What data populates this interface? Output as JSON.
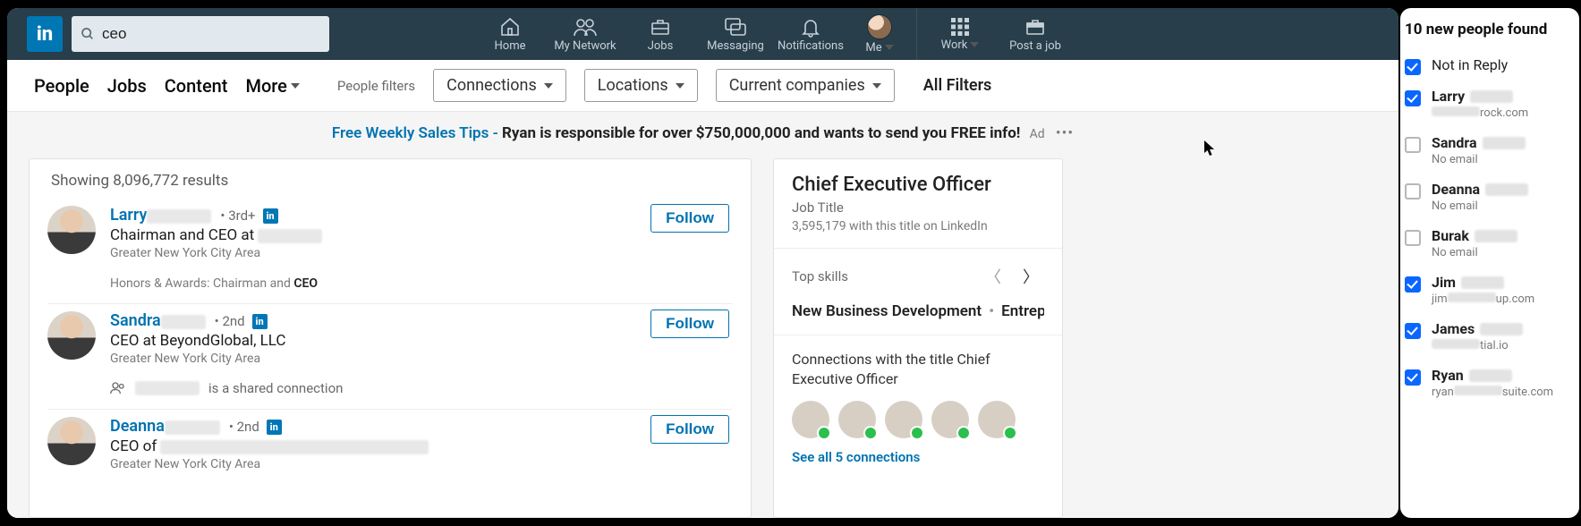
{
  "nav": {
    "logo_text": "in",
    "search_value": "ceo",
    "items": [
      {
        "label": "Home"
      },
      {
        "label": "My Network"
      },
      {
        "label": "Jobs"
      },
      {
        "label": "Messaging"
      },
      {
        "label": "Notifications"
      },
      {
        "label": "Me"
      },
      {
        "label": "Work"
      },
      {
        "label": "Post a job"
      }
    ]
  },
  "filters": {
    "tabs": [
      "People",
      "Jobs",
      "Content",
      "More"
    ],
    "people_filters_label": "People filters",
    "pills": [
      "Connections",
      "Locations",
      "Current companies"
    ],
    "all_label": "All Filters"
  },
  "ad": {
    "link_text": "Free Weekly Sales Tips -",
    "bold_text": " Ryan is responsible for over $750,000,000 and wants to send you FREE info!",
    "ad_label": "Ad"
  },
  "results": {
    "count_text": "Showing 8,096,772 results",
    "follow_label": "Follow",
    "items": [
      {
        "name": "Larry",
        "degree": "• 3rd+",
        "headline": "Chairman and CEO at",
        "location": "Greater New York City Area",
        "extra_prefix": "Honors & Awards: Chairman and ",
        "extra_bold": "CEO"
      },
      {
        "name": "Sandra",
        "degree": "• 2nd",
        "headline": "CEO at BeyondGlobal, LLC",
        "location": "Greater New York City Area",
        "shared_suffix": "is a shared connection"
      },
      {
        "name": "Deanna",
        "degree": "• 2nd",
        "headline": "CEO of",
        "location": "Greater New York City Area"
      }
    ]
  },
  "right": {
    "title": "Chief Executive Officer",
    "subtitle": "Job Title",
    "stat": "3,595,179 with this title on LinkedIn",
    "top_skills_label": "Top skills",
    "skills": [
      "New Business Development",
      "Entrepreneurship"
    ],
    "connections_title": "Connections with the title Chief Executive Officer",
    "see_all": "See all 5 connections"
  },
  "sidebar": {
    "header": "10 new people found",
    "not_in_reply": {
      "label": "Not in Reply",
      "checked": true
    },
    "people": [
      {
        "name": "Larry",
        "email_suffix": "rock.com",
        "checked": true
      },
      {
        "name": "Sandra",
        "email": "No email",
        "checked": false
      },
      {
        "name": "Deanna",
        "email": "No email",
        "checked": false
      },
      {
        "name": "Burak",
        "email": "No email",
        "checked": false
      },
      {
        "name": "Jim",
        "email_prefix": "jim",
        "email_suffix": "up.com",
        "checked": true
      },
      {
        "name": "James",
        "email_suffix": "tial.io",
        "checked": true
      },
      {
        "name": "Ryan",
        "email_prefix": "ryan",
        "email_suffix": "suite.com",
        "checked": true
      }
    ]
  }
}
